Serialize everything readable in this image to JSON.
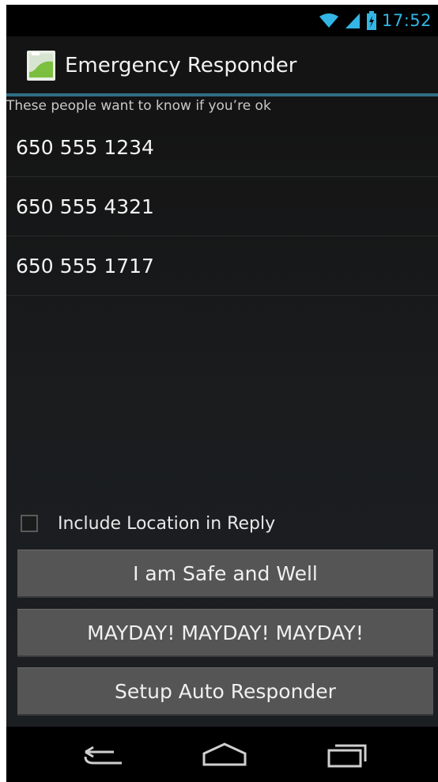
{
  "status_bar": {
    "time": "17:52",
    "icons": [
      "wifi-icon",
      "signal-icon",
      "battery-icon"
    ],
    "accent_color": "#33b5e5"
  },
  "action_bar": {
    "title": "Emergency Responder",
    "icon": "app-icon"
  },
  "subheader": "These people want to know if you’re ok",
  "requesters": [
    {
      "number": "650 555 1234"
    },
    {
      "number": "650 555 4321"
    },
    {
      "number": "650 555 1717"
    }
  ],
  "location_checkbox": {
    "label": "Include Location in Reply",
    "checked": false
  },
  "buttons": {
    "safe": "I am Safe and Well",
    "mayday": "MAYDAY! MAYDAY! MAYDAY!",
    "auto": "Setup Auto Responder"
  },
  "nav": {
    "icons": [
      "back-icon",
      "home-icon",
      "recent-apps-icon"
    ]
  }
}
